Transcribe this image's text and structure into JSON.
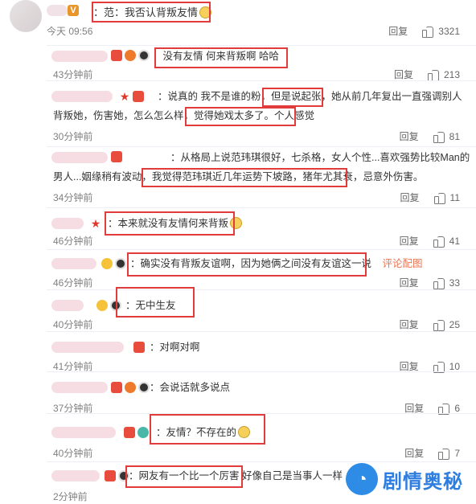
{
  "top_comment": {
    "badge": "V",
    "text": "：范：我否认背叛友情",
    "time": "今天 09:56",
    "reply": "回复",
    "likes": "3321"
  },
  "replies": [
    {
      "text": "：没有友情 何来背叛啊 哈哈",
      "time": "43分钟前",
      "reply": "回复",
      "likes": "213"
    },
    {
      "text_a": "：说真的 我不是谁的粉，但是说起张，她从前几年复出一直强调别人",
      "text_b": "背叛她，伤害她，怎么怎么样，觉得她戏太多了。个人感觉",
      "time": "30分钟前",
      "reply": "回复",
      "likes": "81"
    },
    {
      "text_a": "：从格局上说范玮琪很好，七杀格，女人个性...喜欢强势比较Man的",
      "text_b": "男人...姻缘稍有波动，我觉得范玮琪近几年运势下坡路，猪年尤其衰，忌意外伤害。",
      "time": "34分钟前",
      "reply": "回复",
      "likes": "11"
    },
    {
      "text": "：本来就没有友情何来背叛",
      "time": "46分钟前",
      "reply": "回复",
      "likes": "41"
    },
    {
      "text": "：确实没有背叛友谊啊，因为她俩之间没有友谊这一说",
      "extra": "评论配图",
      "time": "46分钟前",
      "reply": "回复",
      "likes": "33"
    },
    {
      "text": "：无中生友",
      "time": "40分钟前",
      "reply": "回复",
      "likes": "25"
    },
    {
      "text": "：对啊对啊",
      "time": "41分钟前",
      "reply": "回复",
      "likes": "10"
    },
    {
      "text": "：会说话就多说点",
      "time": "37分钟前",
      "reply": "回复",
      "likes": "6"
    },
    {
      "text": "：友情？不存在的",
      "time": "40分钟前",
      "reply": "回复",
      "likes": "7"
    },
    {
      "text": "：网友有一个比一个厉害 好像自己是当事人一样",
      "time": "2分钟前",
      "reply": "回复",
      "likes": ""
    }
  ],
  "watermark": {
    "text": "剧情奥秘"
  },
  "colors": {
    "highlight": "#e23b3b",
    "watermark": "#2e7ee0"
  }
}
